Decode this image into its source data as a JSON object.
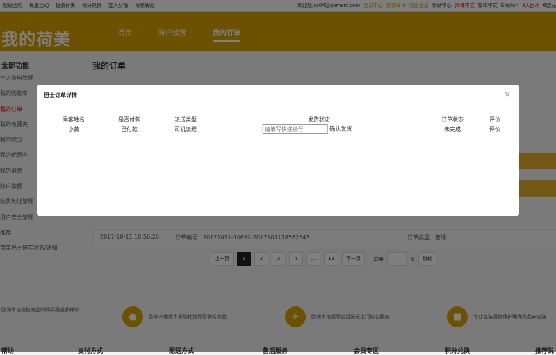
{
  "topbar": {
    "links": [
      "超级团购",
      "优惠活动",
      "投资荷美",
      "积分兑换",
      "加入分销",
      "荷美解密"
    ],
    "welcome": "欢迎您,cs04@gomenl.com",
    "member_center": "会员中心",
    "cart": "购物车 0",
    "logout": "退出登录",
    "help": "帮助中心",
    "lang_simplified": "简体中文",
    "lang_traditional": "繁体中文",
    "lang_english": "English",
    "currency_rmb": "¥人民币",
    "currency_eur": "€欧元"
  },
  "header": {
    "logo": "我的荷美",
    "nav": [
      "首页",
      "账户设置",
      "我的订单"
    ]
  },
  "sidebar": {
    "title": "全部功能",
    "items": [
      "个人资料管理",
      "我的购物车",
      "我的订单",
      "我的收藏夹",
      "我的积分",
      "我的优惠券",
      "我的消息",
      "账户余额",
      "收货地址管理",
      "用户安全管理",
      "推荐",
      "荷美巴士接车状态/通知"
    ]
  },
  "main": {
    "title": "我的订单"
  },
  "order_row": {
    "time": "2017-10-11 18:56:26",
    "order_no": "订单编号：20171011-10692-20171011185626​43",
    "order_type": "订单类型：普通"
  },
  "pagination": {
    "prev": "上一页",
    "pages": [
      "1",
      "2",
      "3",
      "4",
      "...",
      "18"
    ],
    "next": "下一页",
    "goto_label": "向第",
    "page_unit": "页",
    "jump": "跳转"
  },
  "features": [
    "欧洲本地销售商品的购买渠道多样和",
    "欧洲本地超市采购杜绝假冒伪劣商品",
    "欧洲本地国际空运送达上门核心服务",
    "专业包装运输保护确保商品安全送"
  ],
  "footer": [
    "帮助",
    "支付方式",
    "配送方式",
    "售后服务",
    "会员专区",
    "积分兑换",
    "推荐说"
  ],
  "modal": {
    "title": "巴士订单详情",
    "close": "×",
    "headers": {
      "name": "乘客姓名",
      "paid": "是否付款",
      "delivery": "派送类型",
      "ship_status": "发货状态",
      "order_status": "订单状态",
      "review": "评价"
    },
    "row": {
      "name": "小黄",
      "paid": "已付款",
      "delivery": "司机派送",
      "ship_placeholder": "请填写快递编号",
      "confirm": "确认发货",
      "order_status": "未完成",
      "review": "评价"
    }
  }
}
